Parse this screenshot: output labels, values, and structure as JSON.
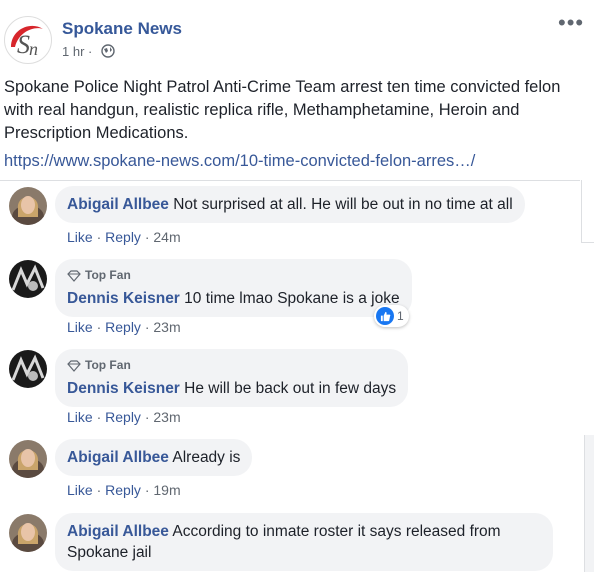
{
  "post": {
    "page_name": "Spokane News",
    "time": "1 hr ·",
    "text": "Spokane Police Night Patrol Anti-Crime Team arrest ten time convicted felon with real handgun, realistic replica rifle, Methamphetamine, Heroin and Prescription Medications.",
    "link": "https://www.spokane-news.com/10-time-convicted-felon-arres…/"
  },
  "labels": {
    "like": "Like",
    "reply": "Reply",
    "top_fan": "Top Fan",
    "dot": "·"
  },
  "comments": [
    {
      "author": "Abigail Allbee",
      "text": "Not surprised at all. He will be out in no time at all",
      "time": "24m"
    },
    {
      "author": "Dennis Keisner",
      "text": "10 time lmao Spokane is a joke",
      "time": "23m",
      "top_fan": true,
      "reactions": "1"
    },
    {
      "author": "Dennis Keisner",
      "text": "He will be back out in few days",
      "time": "23m",
      "top_fan": true
    },
    {
      "author": "Abigail Allbee",
      "text": "Already is",
      "time": "19m"
    },
    {
      "author": "Abigail Allbee",
      "text": "According to inmate roster it says released from Spokane jail"
    }
  ],
  "colors": {
    "author_link": "#385898",
    "bubble_bg": "#f2f3f5",
    "reaction_blue": "#1877f2",
    "logo_red": "#d7262c"
  }
}
